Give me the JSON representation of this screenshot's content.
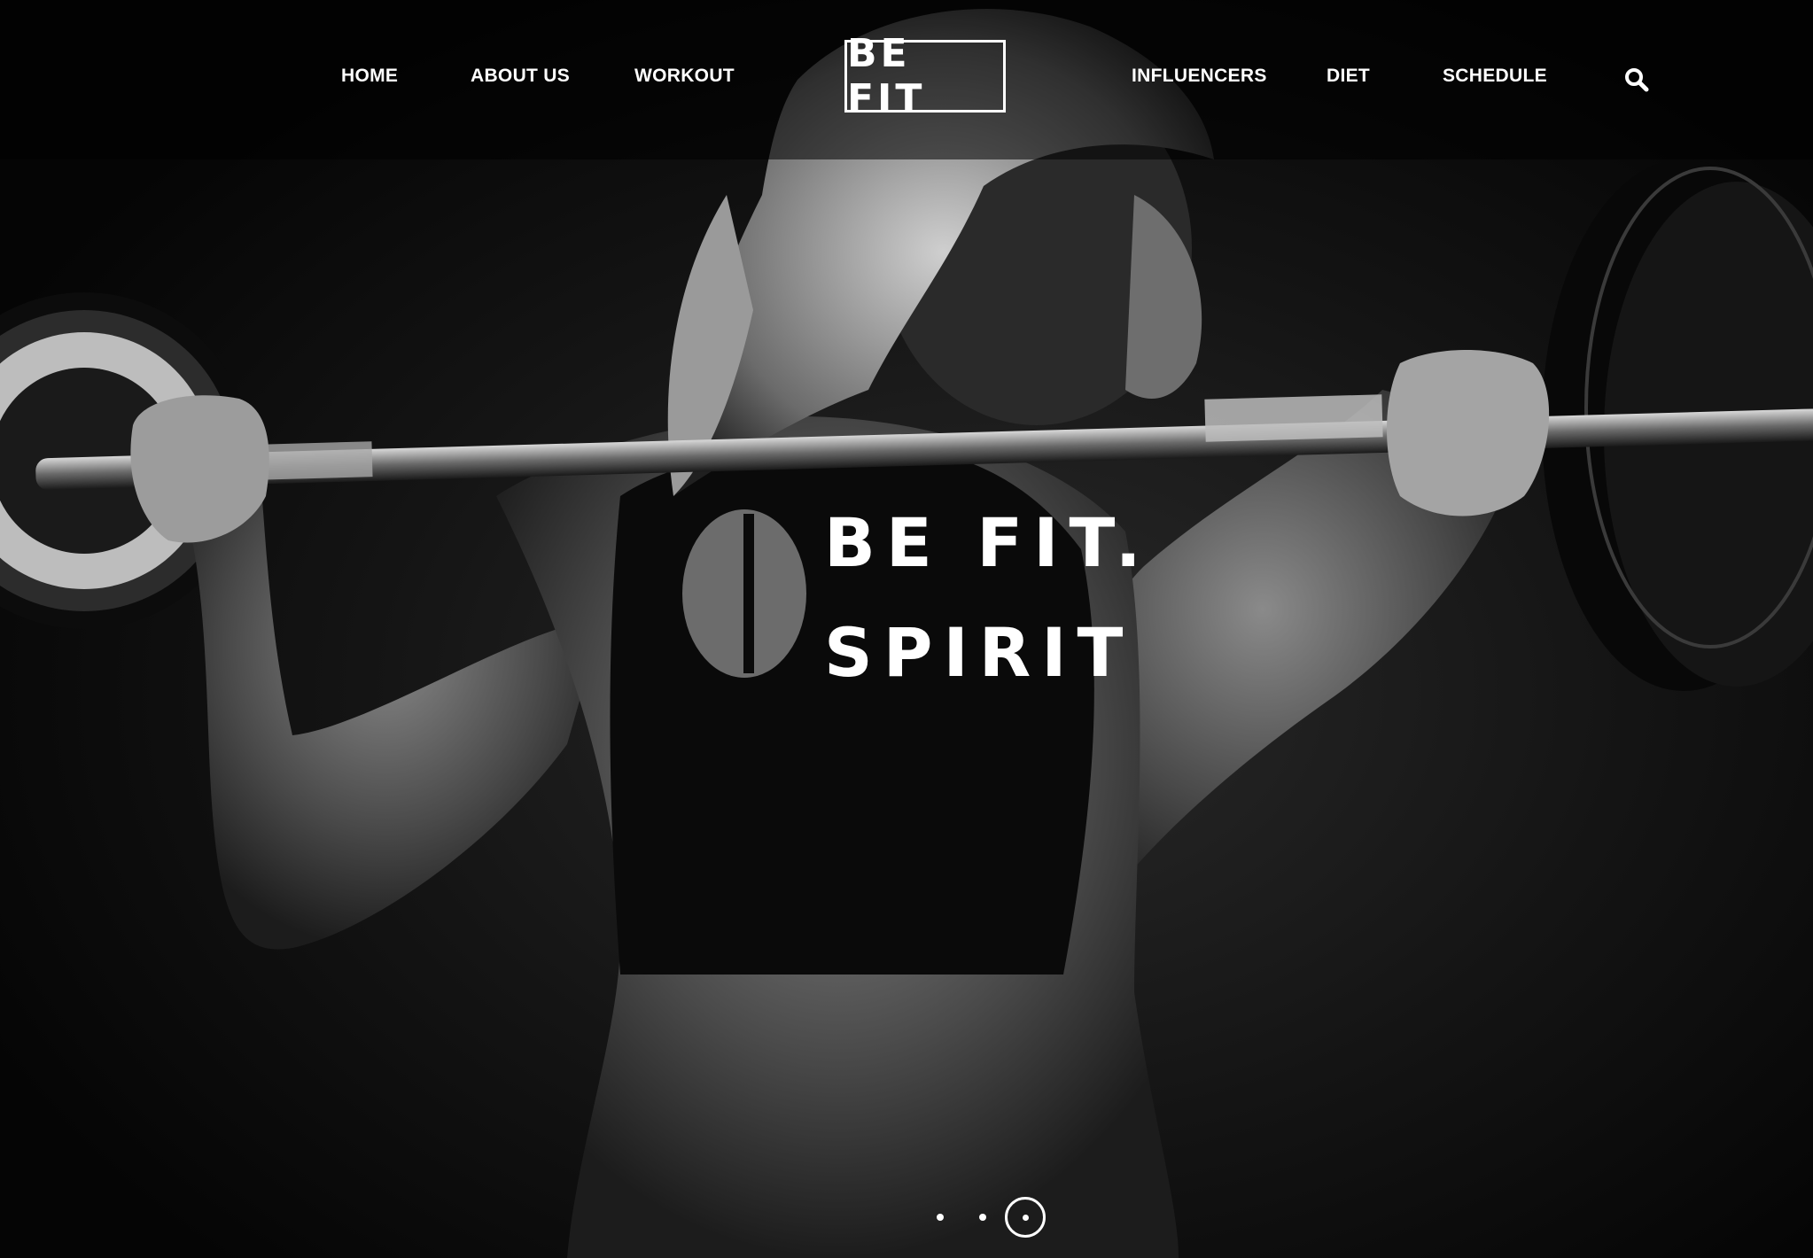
{
  "nav": {
    "items": [
      {
        "label": "HOME"
      },
      {
        "label": "ABOUT US"
      },
      {
        "label": "WORKOUT"
      },
      {
        "label": "INFLUENCERS"
      },
      {
        "label": "DIET"
      },
      {
        "label": "SCHEDULE"
      }
    ],
    "logo": "BE FIT",
    "search_icon": "search-icon"
  },
  "hero": {
    "headline_line1": "BE FIT.",
    "headline_line2": "SPIRIT",
    "image": "woman-lifting-barbell-photo",
    "slider": {
      "total_slides": 3,
      "active_slide": 3
    }
  },
  "colors": {
    "text": "#ffffff",
    "background": "#000000",
    "nav_overlay": "rgba(0,0,0,0.55)"
  }
}
